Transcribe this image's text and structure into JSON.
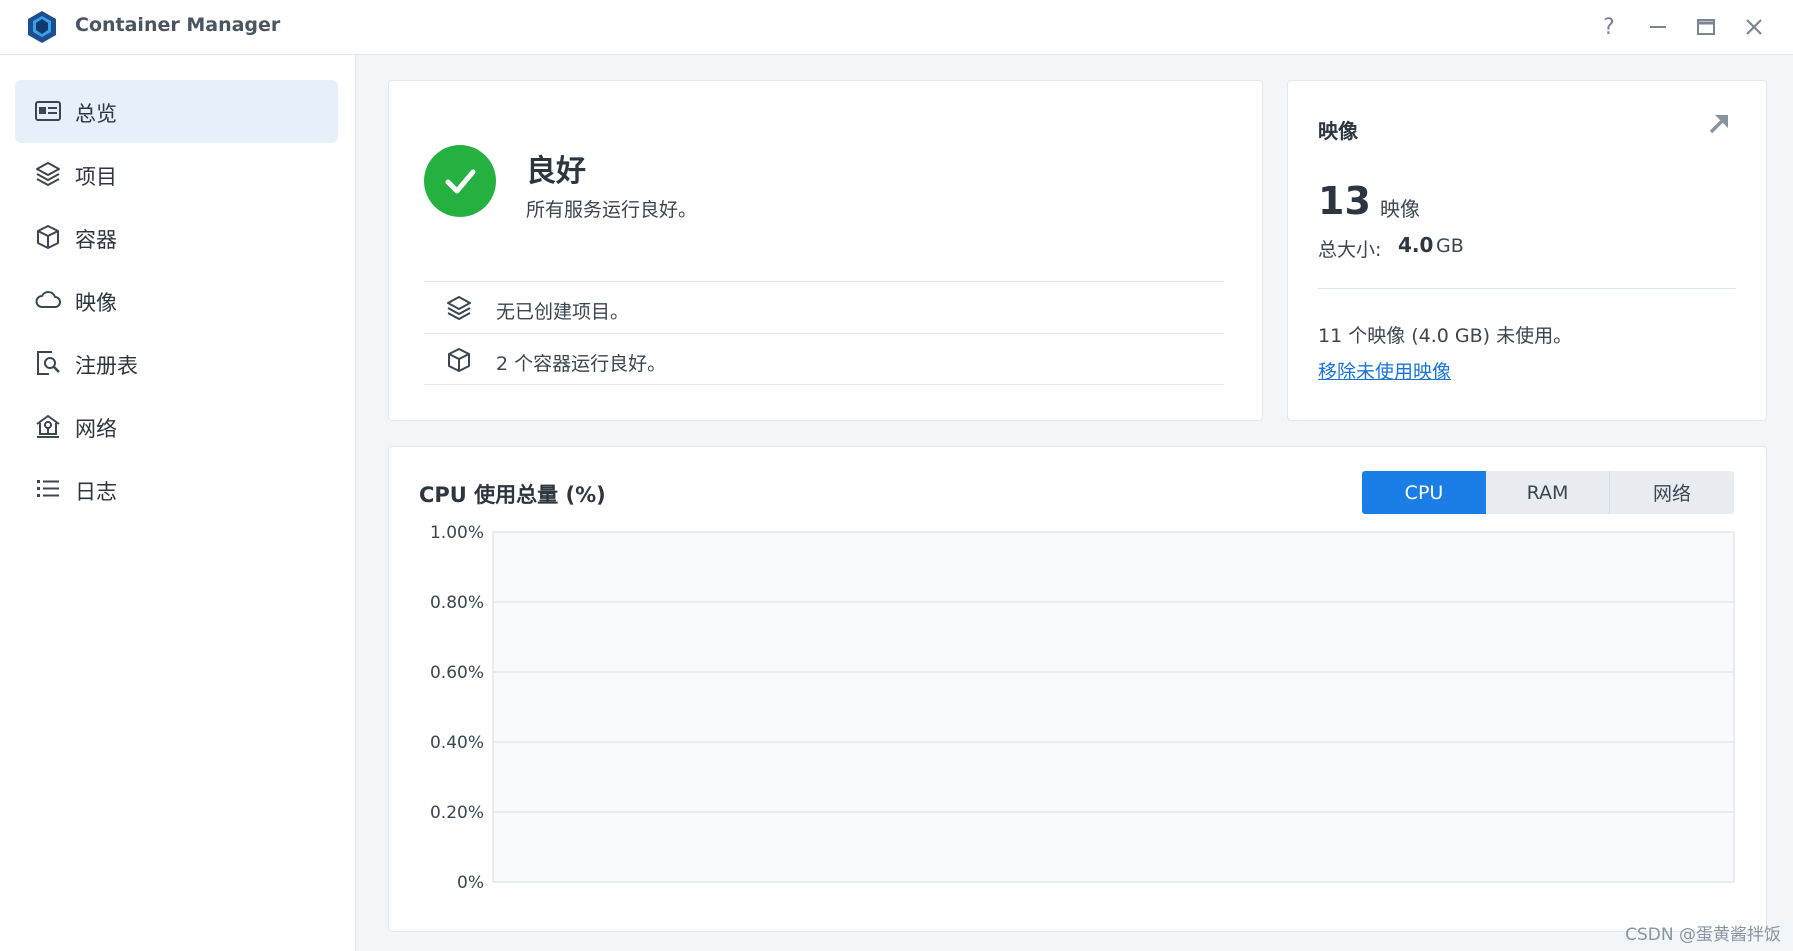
{
  "app": {
    "title": "Container Manager",
    "help_icon": "?",
    "minimize_icon": "—",
    "maximize_icon": "□",
    "close_icon": "✕"
  },
  "sidebar": {
    "items": [
      {
        "label": "总览",
        "icon": "overview-icon",
        "active": true
      },
      {
        "label": "项目",
        "icon": "layers-icon",
        "active": false
      },
      {
        "label": "容器",
        "icon": "cube-icon",
        "active": false
      },
      {
        "label": "映像",
        "icon": "cloud-icon",
        "active": false
      },
      {
        "label": "注册表",
        "icon": "registry-search-icon",
        "active": false
      },
      {
        "label": "网络",
        "icon": "network-house-icon",
        "active": false
      },
      {
        "label": "日志",
        "icon": "list-icon",
        "active": false
      }
    ]
  },
  "status": {
    "title": "良好",
    "description": "所有服务运行良好。",
    "rows": [
      {
        "icon": "layers-icon",
        "text": "无已创建项目。"
      },
      {
        "icon": "cube-icon",
        "text": "2 个容器运行良好。"
      }
    ]
  },
  "images": {
    "title": "映像",
    "count": "13",
    "count_unit": "映像",
    "size_label": "总大小:",
    "size_value": "4.0",
    "size_unit": "GB",
    "unused_text": "11 个映像 (4.0 GB) 未使用。",
    "remove_link": "移除未使用映像"
  },
  "chart": {
    "title": "CPU 使用总量 (%)",
    "tabs": [
      {
        "label": "CPU",
        "active": true
      },
      {
        "label": "RAM",
        "active": false
      },
      {
        "label": "网络",
        "active": false
      }
    ]
  },
  "chart_data": {
    "type": "line",
    "title": "CPU 使用总量 (%)",
    "xlabel": "",
    "ylabel": "",
    "ylim": [
      0,
      1.0
    ],
    "y_ticks": [
      "1.00%",
      "0.80%",
      "0.60%",
      "0.40%",
      "0.20%",
      "0%"
    ],
    "series": []
  },
  "watermark": "CSDN @蛋黄酱拌饭",
  "colors": {
    "accent": "#1a7ee6",
    "success": "#25b13f",
    "link": "#1a73d9"
  }
}
